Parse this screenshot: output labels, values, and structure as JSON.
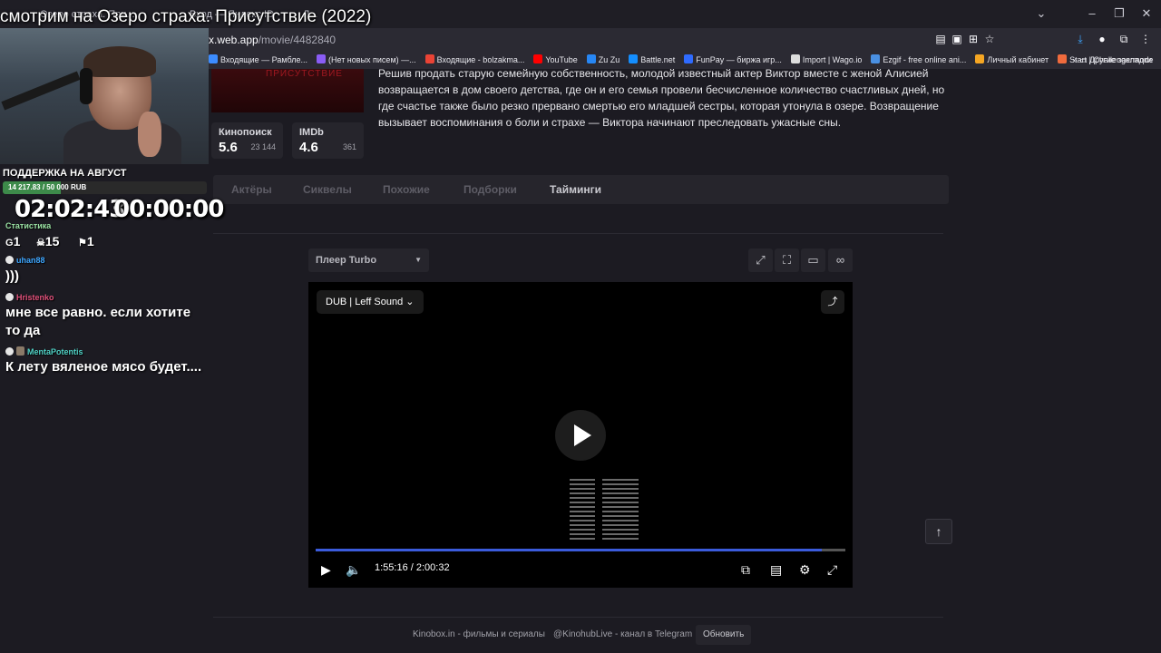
{
  "stream": {
    "title": "смотрим на Озеро страха. Присутствие (2022)",
    "donation": {
      "title": "ПОДДЕРЖКА НА АВГУСТ",
      "progress_text": "14 217.83 / 50 000 RUB",
      "progress_fraction": 0.284
    },
    "timers": {
      "elapsed": "02:02:43",
      "second": "00:00:00"
    },
    "stats": {
      "label": "Статистика",
      "items": [
        {
          "icon": "g-icon",
          "value": "1"
        },
        {
          "icon": "skull-icon",
          "value": "15"
        },
        {
          "icon": "flag-icon",
          "value": "1"
        }
      ]
    },
    "chat": [
      {
        "user": "uhan88",
        "color": "#3ea6ff",
        "message": ")))"
      },
      {
        "user": "Hristenko",
        "color": "#e0507a",
        "message": "мне все равно. если хотите то да"
      },
      {
        "user": "MentaPotentis",
        "color": "#4fd1c5",
        "message": "К лету вяленое мясо будет...."
      }
    ]
  },
  "browser": {
    "tabs": [
      "Озеро страха. При...",
      "Вход — Яндекс ID",
      "Л..."
    ],
    "url_host": "x.web.app",
    "url_path": "/movie/4482840",
    "bookmarks": [
      {
        "label": "Входящие — Рамбле...",
        "color": "#3c8cff"
      },
      {
        "label": "(Нет новых писем) —...",
        "color": "#8a5cf5"
      },
      {
        "label": "Входящие - bolzakma...",
        "color": "#ea4335"
      },
      {
        "label": "YouTube",
        "color": "#ff0000"
      },
      {
        "label": "Zu Zu",
        "color": "#2787f5"
      },
      {
        "label": "Battle.net",
        "color": "#148eff"
      },
      {
        "label": "FunPay — биржа игр...",
        "color": "#2f6bff"
      },
      {
        "label": "Import | Wago.io",
        "color": "#dddddd"
      },
      {
        "label": "Ezgif - free online ani...",
        "color": "#4a90e2"
      },
      {
        "label": "Личный кабинет",
        "color": "#f5a623"
      },
      {
        "label": "Start | Challengermode",
        "color": "#f06b3d"
      }
    ],
    "other_bookmarks": "Другие закладки",
    "accent": "#2b2a33"
  },
  "movie": {
    "description": "Решив продать старую семейную собственность, молодой известный актер Виктор вместе с женой Алисией возвращается в дом своего детства, где он и его семья провели бесчисленное количество счастливых дней, но где счастье также было резко прервано смертью его младшей сестры, которая утонула в озере. Возвращение вызывает воспоминания о боли и страхе — Виктора начинают преследовать ужасные сны.",
    "ratings": [
      {
        "name": "Кинопоиск",
        "value": "5.6",
        "votes": "23 144"
      },
      {
        "name": "IMDb",
        "value": "4.6",
        "votes": "361"
      }
    ],
    "tabs": [
      "Актёры",
      "Сиквелы",
      "Похожие",
      "Подборки",
      "Тайминги"
    ]
  },
  "player": {
    "selector": "Плеер Turbo",
    "dub": "DUB | Leff Sound",
    "current_time": "1:55:16",
    "duration": "2:00:32",
    "progress_fraction": 0.956,
    "accent": "#3b5bdb"
  },
  "footer": {
    "site": "Kinobox.in - фильмы и сериалы",
    "telegram": "@KinohubLive - канал в Telegram",
    "refresh": "Обновить"
  }
}
